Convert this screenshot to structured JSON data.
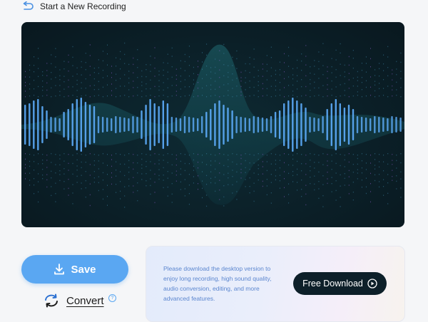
{
  "header": {
    "back_label": "Start a New Recording",
    "back_icon": "undo-arrow-icon"
  },
  "waveform": {
    "colors": {
      "bars": "#5aa7f2",
      "glow": "#1f6a72",
      "background": "#0b1f27"
    }
  },
  "actions": {
    "save_label": "Save",
    "save_icon": "download-icon",
    "convert_label": "Convert",
    "convert_icon": "refresh-arrows-icon",
    "help_glyph": "?"
  },
  "promo": {
    "text": "Please download the desktop version to enjoy long recording, high sound quality, audio conversion, editing, and more advanced features.",
    "button_label": "Free Download",
    "button_icon": "play-circle-icon"
  },
  "colors": {
    "accent": "#5aa7f2",
    "dark": "#0d1f29"
  }
}
